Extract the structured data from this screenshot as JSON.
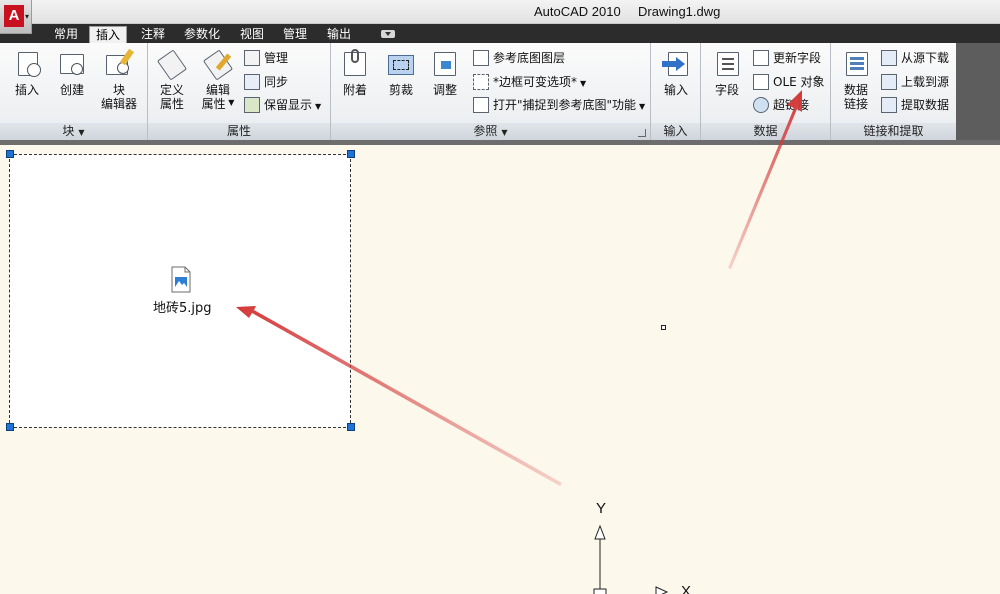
{
  "titlebar": {
    "app": "AutoCAD 2010",
    "document": "Drawing1.dwg"
  },
  "tabs": [
    {
      "label": "常用",
      "active": false
    },
    {
      "label": "插入",
      "active": true
    },
    {
      "label": "注释",
      "active": false
    },
    {
      "label": "参数化",
      "active": false
    },
    {
      "label": "视图",
      "active": false
    },
    {
      "label": "管理",
      "active": false
    },
    {
      "label": "输出",
      "active": false
    }
  ],
  "ribbon": {
    "block": {
      "title": "块",
      "insert": "插入",
      "create": "创建",
      "editor_line1": "块",
      "editor_line2": "编辑器"
    },
    "attributes": {
      "title": "属性",
      "define_line1": "定义",
      "define_line2": "属性",
      "edit_line1": "编辑",
      "edit_line2": "属性",
      "manage": "管理",
      "sync": "同步",
      "retain": "保留显示"
    },
    "reference": {
      "title": "参照",
      "attach": "附着",
      "clip": "剪裁",
      "adjust": "调整",
      "underlay_layers": "参考底图图层",
      "frame_option": "*边框可变选项*",
      "snap_option": "打开\"捕捉到参考底图\"功能"
    },
    "import": {
      "title": "输入",
      "button": "输入"
    },
    "data": {
      "title": "数据",
      "field": "字段",
      "update_fields": "更新字段",
      "ole_object": "OLE 对象",
      "hyperlink": "超链接"
    },
    "linking": {
      "title": "链接和提取",
      "data_link_line1": "数据",
      "data_link_line2": "链接",
      "download": "从源下载",
      "upload": "上载到源",
      "extract": "提取数据"
    }
  },
  "canvas": {
    "ole_file_label": "地砖5.jpg",
    "ucs_y": "Y",
    "ucs_x": "X"
  },
  "colors": {
    "accent": "#1e74d6",
    "annotation_arrow": "#d43a3a",
    "canvas": "#fdf8ec"
  }
}
